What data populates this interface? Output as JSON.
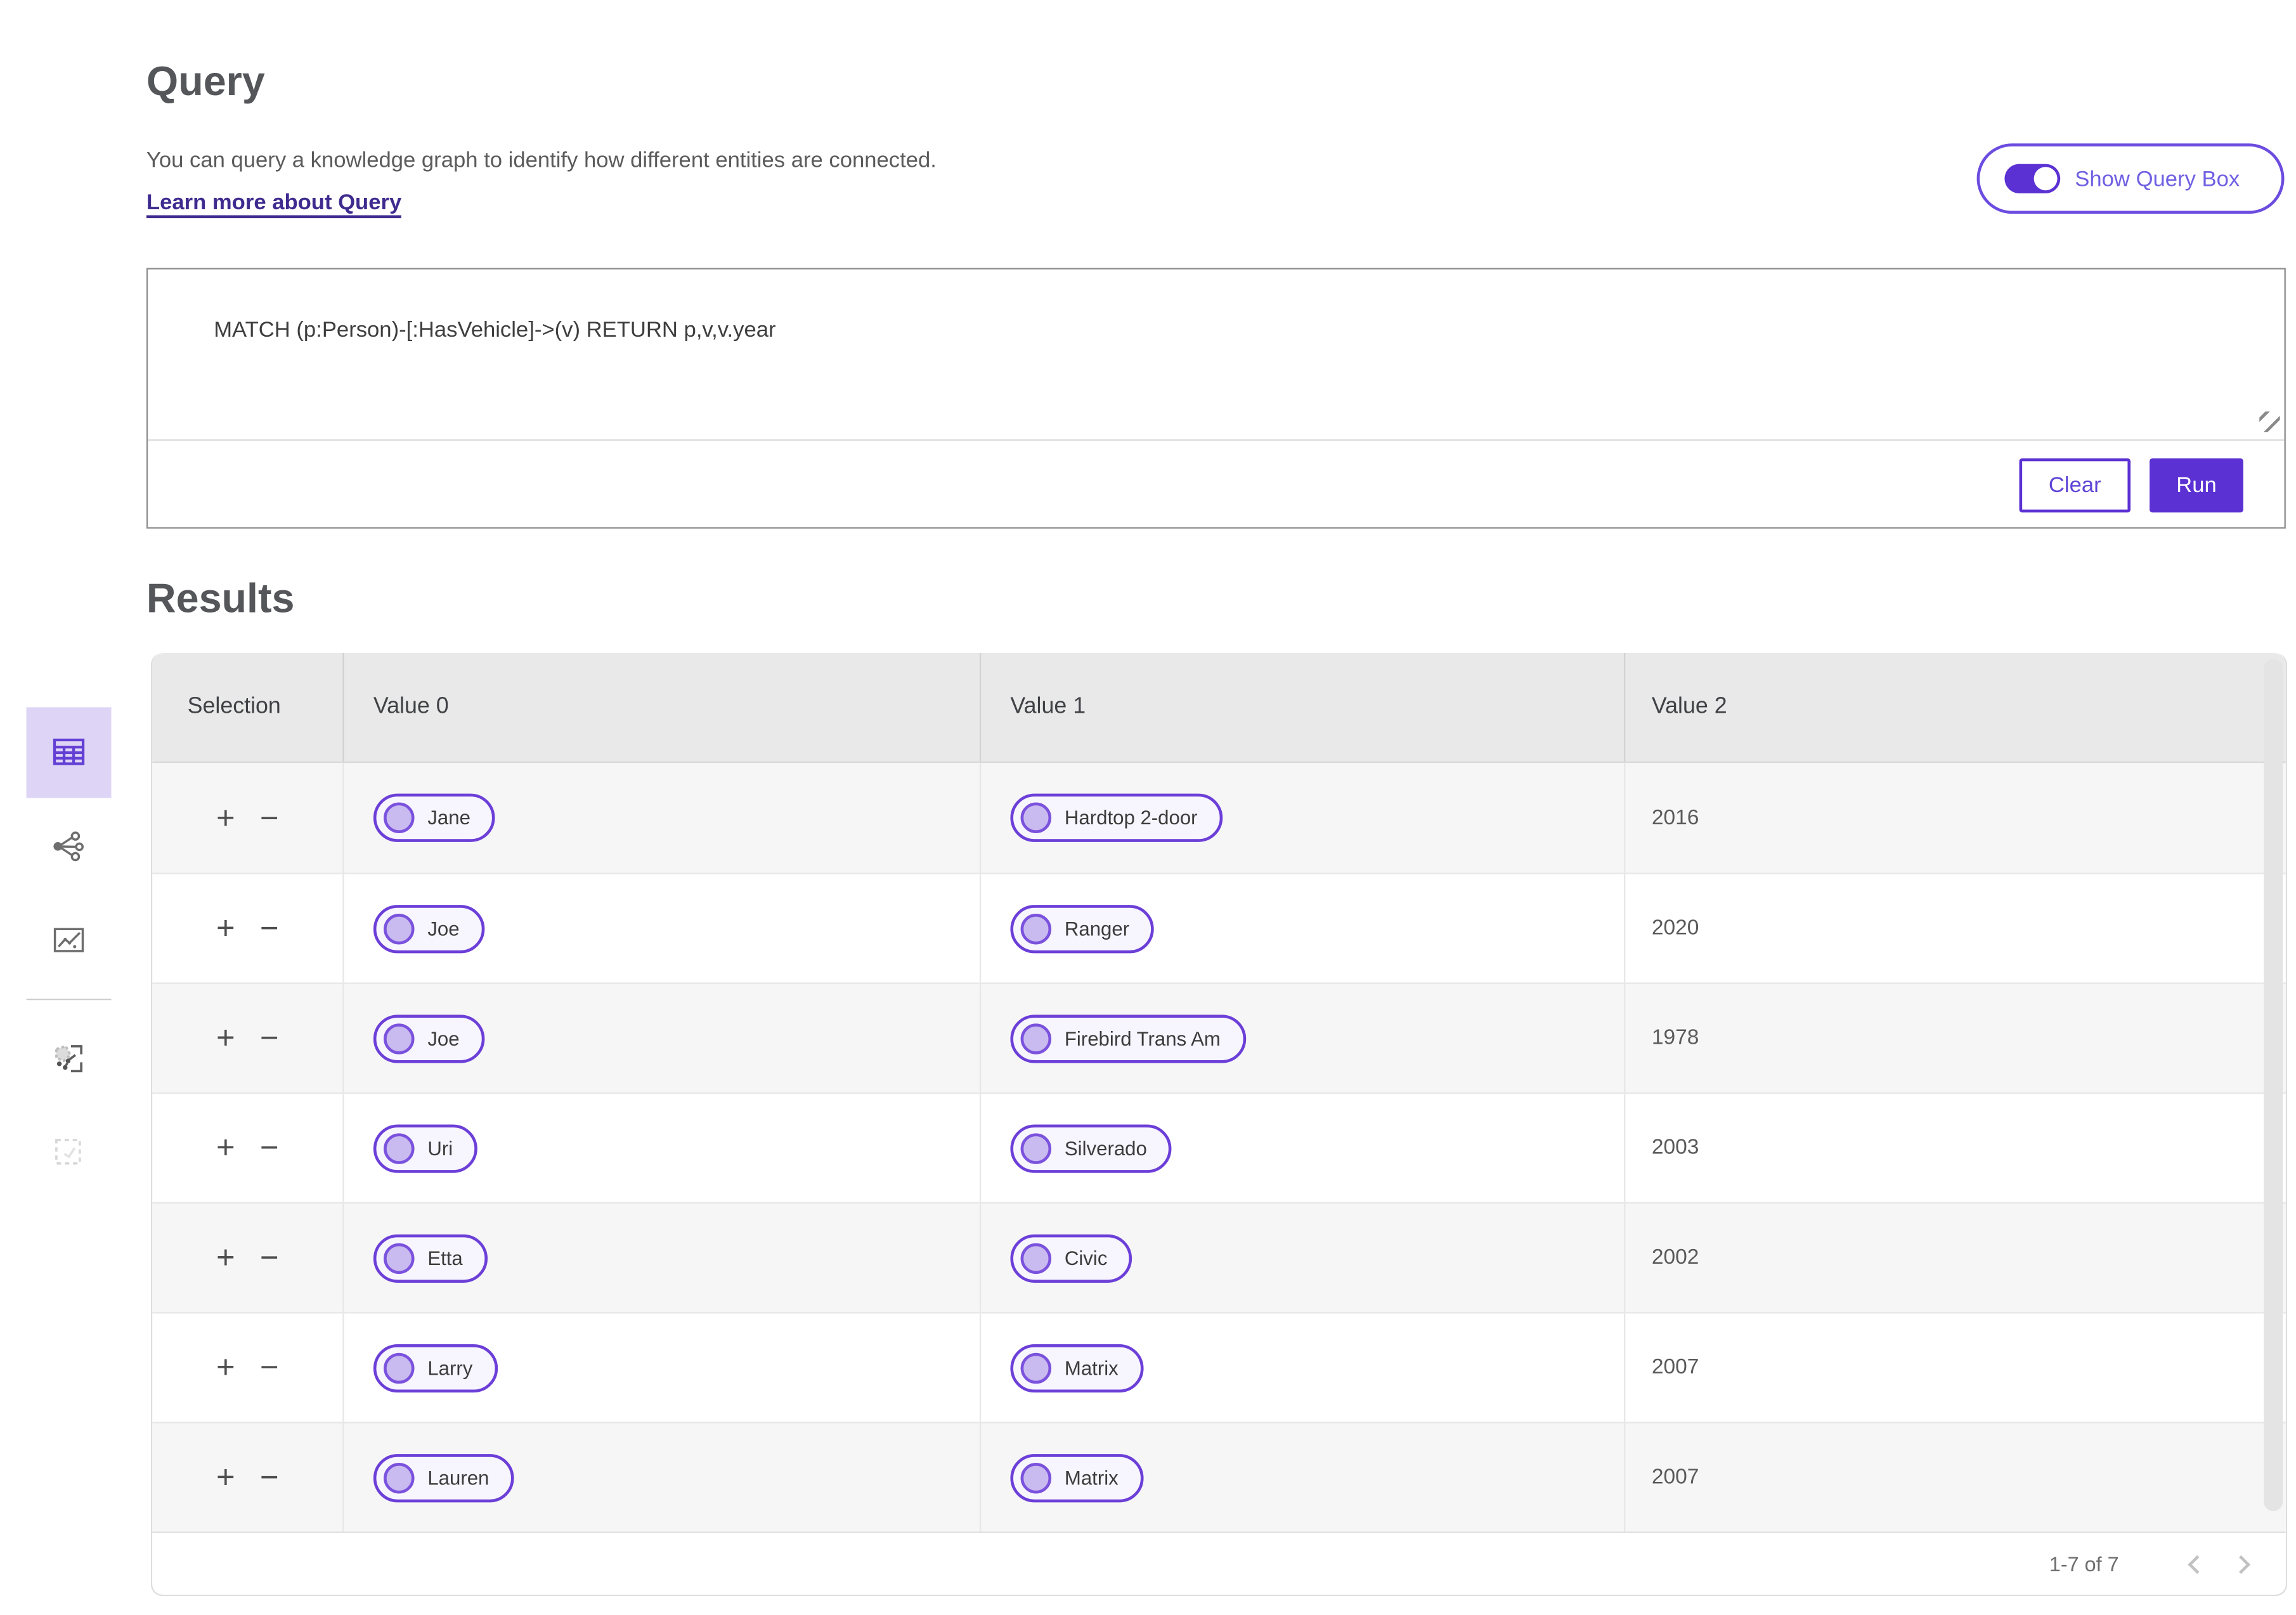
{
  "query_section": {
    "title": "Query",
    "description": "You can query a knowledge graph to identify how different entities are connected.",
    "learn_more_label": "Learn more about Query",
    "toggle_label": "Show Query Box",
    "toggle_state": "on",
    "query_text": "MATCH (p:Person)-[:HasVehicle]->(v) RETURN p,v,v.year",
    "clear_label": "Clear",
    "run_label": "Run"
  },
  "results_section": {
    "title": "Results",
    "columns": [
      "Selection",
      "Value 0",
      "Value 1",
      "Value 2"
    ],
    "expand_label": "+",
    "collapse_label": "−",
    "rows": [
      {
        "value0": "Jane",
        "value1": "Hardtop 2-door",
        "value2": "2016"
      },
      {
        "value0": "Joe",
        "value1": "Ranger",
        "value2": "2020"
      },
      {
        "value0": "Joe",
        "value1": "Firebird Trans Am",
        "value2": "1978"
      },
      {
        "value0": "Uri",
        "value1": "Silverado",
        "value2": "2003"
      },
      {
        "value0": "Etta",
        "value1": "Civic",
        "value2": "2002"
      },
      {
        "value0": "Larry",
        "value1": "Matrix",
        "value2": "2007"
      },
      {
        "value0": "Lauren",
        "value1": "Matrix",
        "value2": "2007"
      }
    ],
    "pagination": {
      "range_label": "1-7 of 7",
      "prev_icon": "chevron-left-icon",
      "next_icon": "chevron-right-icon"
    }
  },
  "sidebar": {
    "items": [
      {
        "icon": "table-view-icon",
        "active": true
      },
      {
        "icon": "graph-view-icon",
        "active": false
      },
      {
        "icon": "chart-view-icon",
        "active": false
      },
      {
        "icon": "graph-selection-icon",
        "active": false
      },
      {
        "icon": "marquee-selection-icon",
        "active": false
      }
    ]
  },
  "colors": {
    "accent": "#5b31d3",
    "accent_soft": "#ded5f6",
    "pill_border": "#6c3fd8",
    "pill_bg": "#f7f5fe",
    "node_fill": "#c9baf0",
    "header_bg": "#e9e9e9",
    "row_alt_bg": "#f6f6f6",
    "link": "#3f2b8f"
  }
}
